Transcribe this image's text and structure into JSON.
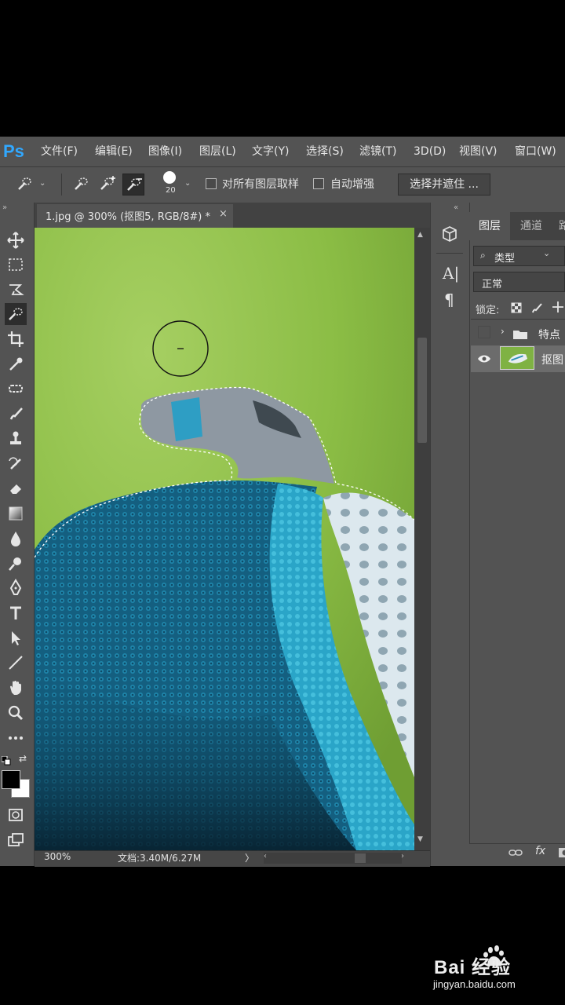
{
  "app": {
    "logo": "Ps"
  },
  "menu": [
    "文件(F)",
    "编辑(E)",
    "图像(I)",
    "图层(L)",
    "文字(Y)",
    "选择(S)",
    "滤镜(T)",
    "3D(D)",
    "视图(V)",
    "窗口(W)"
  ],
  "options": {
    "brush_size": "20",
    "sample_all_layers": "对所有图层取样",
    "auto_enhance": "自动增强",
    "select_and_mask": "选择并遮住 ..."
  },
  "document": {
    "tab_title": "1.jpg @ 300% (抠图5, RGB/8#) *",
    "close": "×"
  },
  "status": {
    "zoom": "300%",
    "doc_size": "文档:3.40M/6.27M",
    "arrow": "〉"
  },
  "panels": {
    "tabs": [
      "图层",
      "通道",
      "路"
    ],
    "filter_kind": "类型",
    "blend_mode": "正常",
    "lock_label": "锁定:",
    "layers": [
      {
        "name": "特点"
      },
      {
        "name": "抠图"
      }
    ],
    "footer_fx": "fx"
  },
  "watermark": {
    "brand": "Bai 经验",
    "url": "jingyan.baidu.com"
  },
  "colors": {
    "ui_bg": "#535353",
    "ui_dark": "#424242",
    "ps_blue": "#31a8ff",
    "grass": "#8bc34a",
    "fabric_teal": "#1f8fb0"
  }
}
